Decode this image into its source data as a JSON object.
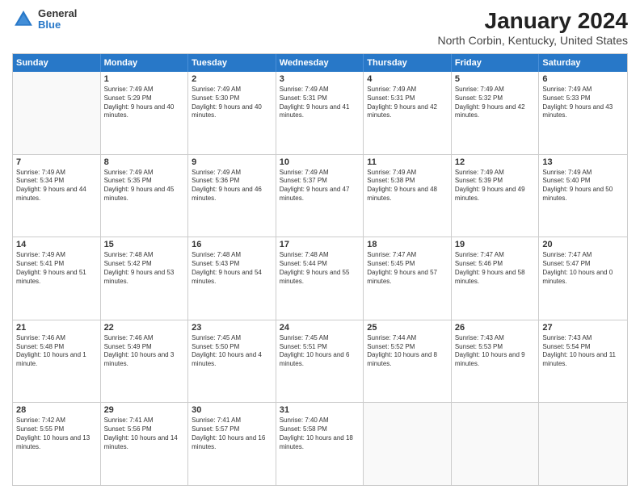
{
  "header": {
    "logo": {
      "general": "General",
      "blue": "Blue"
    },
    "title": "January 2024",
    "subtitle": "North Corbin, Kentucky, United States"
  },
  "dayNames": [
    "Sunday",
    "Monday",
    "Tuesday",
    "Wednesday",
    "Thursday",
    "Friday",
    "Saturday"
  ],
  "weeks": [
    [
      {
        "date": "",
        "empty": true
      },
      {
        "date": "1",
        "sunrise": "7:49 AM",
        "sunset": "5:29 PM",
        "daylight": "9 hours and 40 minutes."
      },
      {
        "date": "2",
        "sunrise": "7:49 AM",
        "sunset": "5:30 PM",
        "daylight": "9 hours and 40 minutes."
      },
      {
        "date": "3",
        "sunrise": "7:49 AM",
        "sunset": "5:31 PM",
        "daylight": "9 hours and 41 minutes."
      },
      {
        "date": "4",
        "sunrise": "7:49 AM",
        "sunset": "5:31 PM",
        "daylight": "9 hours and 42 minutes."
      },
      {
        "date": "5",
        "sunrise": "7:49 AM",
        "sunset": "5:32 PM",
        "daylight": "9 hours and 42 minutes."
      },
      {
        "date": "6",
        "sunrise": "7:49 AM",
        "sunset": "5:33 PM",
        "daylight": "9 hours and 43 minutes."
      }
    ],
    [
      {
        "date": "7",
        "sunrise": "7:49 AM",
        "sunset": "5:34 PM",
        "daylight": "9 hours and 44 minutes."
      },
      {
        "date": "8",
        "sunrise": "7:49 AM",
        "sunset": "5:35 PM",
        "daylight": "9 hours and 45 minutes."
      },
      {
        "date": "9",
        "sunrise": "7:49 AM",
        "sunset": "5:36 PM",
        "daylight": "9 hours and 46 minutes."
      },
      {
        "date": "10",
        "sunrise": "7:49 AM",
        "sunset": "5:37 PM",
        "daylight": "9 hours and 47 minutes."
      },
      {
        "date": "11",
        "sunrise": "7:49 AM",
        "sunset": "5:38 PM",
        "daylight": "9 hours and 48 minutes."
      },
      {
        "date": "12",
        "sunrise": "7:49 AM",
        "sunset": "5:39 PM",
        "daylight": "9 hours and 49 minutes."
      },
      {
        "date": "13",
        "sunrise": "7:49 AM",
        "sunset": "5:40 PM",
        "daylight": "9 hours and 50 minutes."
      }
    ],
    [
      {
        "date": "14",
        "sunrise": "7:49 AM",
        "sunset": "5:41 PM",
        "daylight": "9 hours and 51 minutes."
      },
      {
        "date": "15",
        "sunrise": "7:48 AM",
        "sunset": "5:42 PM",
        "daylight": "9 hours and 53 minutes."
      },
      {
        "date": "16",
        "sunrise": "7:48 AM",
        "sunset": "5:43 PM",
        "daylight": "9 hours and 54 minutes."
      },
      {
        "date": "17",
        "sunrise": "7:48 AM",
        "sunset": "5:44 PM",
        "daylight": "9 hours and 55 minutes."
      },
      {
        "date": "18",
        "sunrise": "7:47 AM",
        "sunset": "5:45 PM",
        "daylight": "9 hours and 57 minutes."
      },
      {
        "date": "19",
        "sunrise": "7:47 AM",
        "sunset": "5:46 PM",
        "daylight": "9 hours and 58 minutes."
      },
      {
        "date": "20",
        "sunrise": "7:47 AM",
        "sunset": "5:47 PM",
        "daylight": "10 hours and 0 minutes."
      }
    ],
    [
      {
        "date": "21",
        "sunrise": "7:46 AM",
        "sunset": "5:48 PM",
        "daylight": "10 hours and 1 minute."
      },
      {
        "date": "22",
        "sunrise": "7:46 AM",
        "sunset": "5:49 PM",
        "daylight": "10 hours and 3 minutes."
      },
      {
        "date": "23",
        "sunrise": "7:45 AM",
        "sunset": "5:50 PM",
        "daylight": "10 hours and 4 minutes."
      },
      {
        "date": "24",
        "sunrise": "7:45 AM",
        "sunset": "5:51 PM",
        "daylight": "10 hours and 6 minutes."
      },
      {
        "date": "25",
        "sunrise": "7:44 AM",
        "sunset": "5:52 PM",
        "daylight": "10 hours and 8 minutes."
      },
      {
        "date": "26",
        "sunrise": "7:43 AM",
        "sunset": "5:53 PM",
        "daylight": "10 hours and 9 minutes."
      },
      {
        "date": "27",
        "sunrise": "7:43 AM",
        "sunset": "5:54 PM",
        "daylight": "10 hours and 11 minutes."
      }
    ],
    [
      {
        "date": "28",
        "sunrise": "7:42 AM",
        "sunset": "5:55 PM",
        "daylight": "10 hours and 13 minutes."
      },
      {
        "date": "29",
        "sunrise": "7:41 AM",
        "sunset": "5:56 PM",
        "daylight": "10 hours and 14 minutes."
      },
      {
        "date": "30",
        "sunrise": "7:41 AM",
        "sunset": "5:57 PM",
        "daylight": "10 hours and 16 minutes."
      },
      {
        "date": "31",
        "sunrise": "7:40 AM",
        "sunset": "5:58 PM",
        "daylight": "10 hours and 18 minutes."
      },
      {
        "date": "",
        "empty": true
      },
      {
        "date": "",
        "empty": true
      },
      {
        "date": "",
        "empty": true
      }
    ]
  ]
}
